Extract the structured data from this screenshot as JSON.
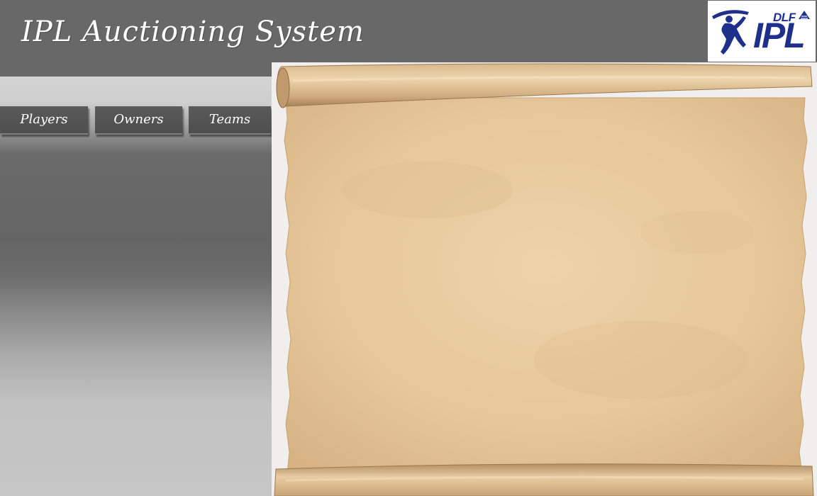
{
  "header": {
    "title": "IPL Auctioning System",
    "logo": {
      "top_text": "DLF",
      "main_text": "IPL",
      "icon": "batsman-logo-icon",
      "color": "#1f2f8c"
    }
  },
  "nav": {
    "tabs": [
      {
        "label": "Players"
      },
      {
        "label": "Owners"
      },
      {
        "label": "Teams"
      }
    ]
  },
  "content": {
    "scroll_icon": "parchment-scroll-icon",
    "parchment_color": "#e7c99c"
  }
}
